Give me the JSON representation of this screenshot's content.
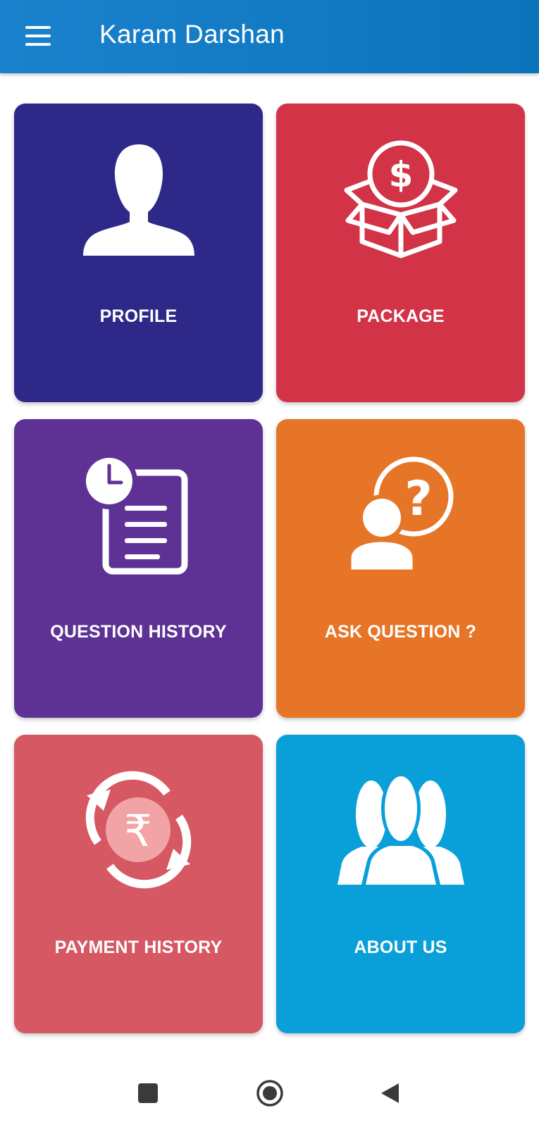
{
  "appbar": {
    "title": "Karam Darshan",
    "menu_icon": "hamburger-menu-icon"
  },
  "tiles": [
    {
      "label": "PROFILE",
      "icon": "profile-user-icon",
      "color": "#2e2889"
    },
    {
      "label": "PACKAGE",
      "icon": "package-box-dollar-icon",
      "color": "#d23346"
    },
    {
      "label": "QUESTION HISTORY",
      "icon": "clock-document-icon",
      "color": "#5e3295"
    },
    {
      "label": "ASK QUESTION ?",
      "icon": "person-question-icon",
      "color": "#e77527"
    },
    {
      "label": "PAYMENT HISTORY",
      "icon": "rupee-refresh-icon",
      "color": "#d65862"
    },
    {
      "label": "ABOUT US",
      "icon": "group-people-icon",
      "color": "#099fd9"
    }
  ],
  "navbar": {
    "recents_icon": "square-recents-icon",
    "home_icon": "circle-home-icon",
    "back_icon": "triangle-back-icon"
  }
}
